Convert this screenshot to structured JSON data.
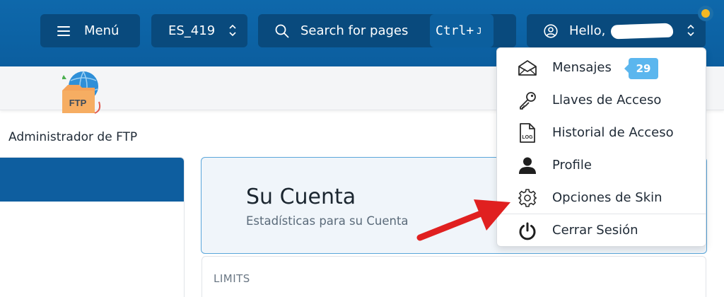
{
  "header": {
    "menu_label": "Menú",
    "language_label": "ES_419",
    "search_placeholder": "Search for pages",
    "search_shortcut": "Ctrl+",
    "search_shortcut_key": "J",
    "user_greeting": "Hello,"
  },
  "user_menu": {
    "items": [
      {
        "label": "Mensajes",
        "icon": "envelope-icon",
        "badge": "29"
      },
      {
        "label": "Llaves de Acceso",
        "icon": "key-icon"
      },
      {
        "label": "Historial de Acceso",
        "icon": "log-file-icon"
      },
      {
        "label": "Profile",
        "icon": "person-icon"
      },
      {
        "label": "Opciones de Skin",
        "icon": "gear-icon"
      },
      {
        "label": "Cerrar Sesión",
        "icon": "power-icon"
      }
    ]
  },
  "account_card": {
    "title": "Su Cuenta",
    "subtitle": "Estadísticas para su Cuenta"
  },
  "limits_section": {
    "label": "LIMITS"
  },
  "left_card": {
    "icon_text": "FTP",
    "caption": "Administrador de FTP"
  },
  "colors": {
    "header_bg": "#0b5e9f",
    "header_button_bg": "#094a7d",
    "badge_bg": "#5bb6ee",
    "notification_dot": "#f4b721",
    "annotation_arrow": "#e02020",
    "account_card_border": "#5aa6da"
  }
}
